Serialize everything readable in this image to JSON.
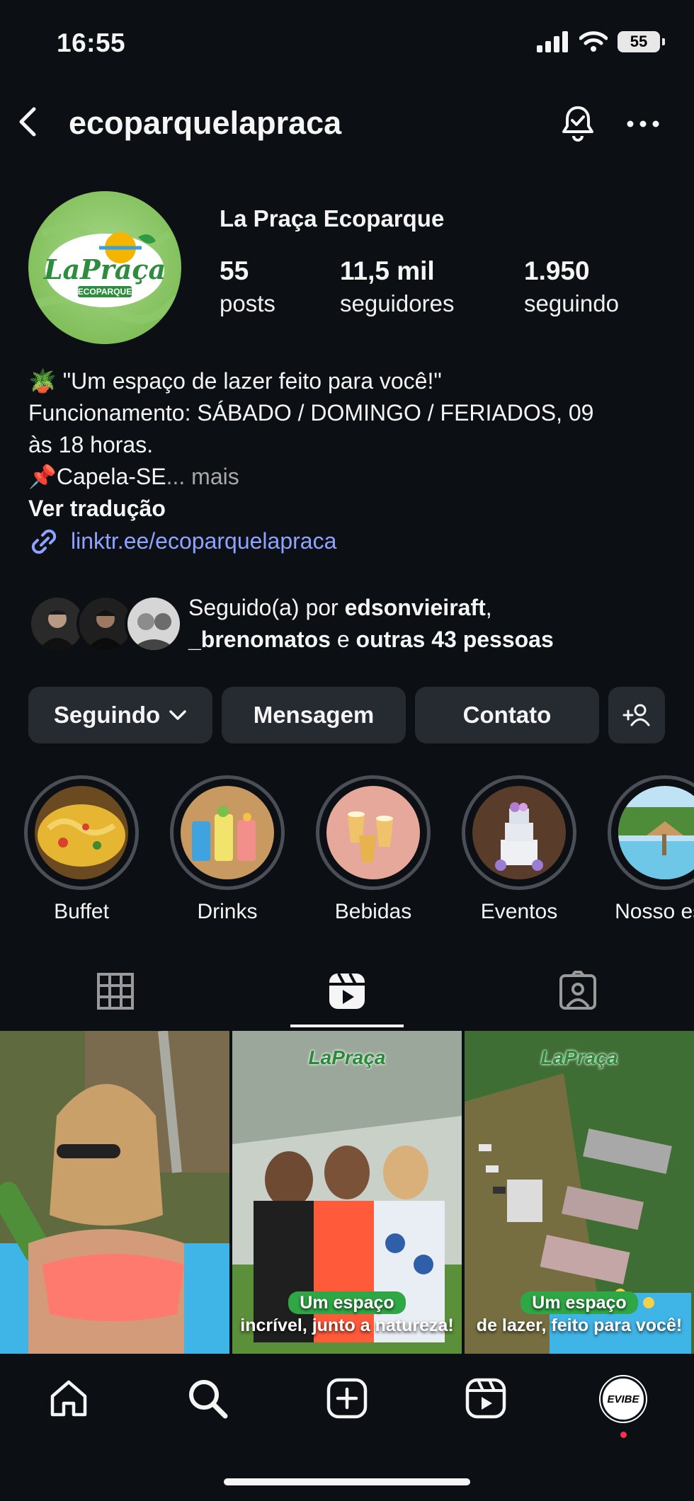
{
  "status_bar": {
    "time": "16:55",
    "battery": "55"
  },
  "header": {
    "username": "ecoparquelapraca"
  },
  "profile": {
    "display_name": "La Praça Ecoparque",
    "avatar_text": "LaPraça",
    "avatar_subtext": "ECOPARQUE",
    "stats": [
      {
        "value": "55",
        "label": "posts"
      },
      {
        "value": "11,5 mil",
        "label": "seguidores"
      },
      {
        "value": "1.950",
        "label": "seguindo"
      }
    ]
  },
  "bio": {
    "line1_emoji": "🪴",
    "line1": "\"Um espaço de lazer feito para você!\"",
    "line2": "Funcionamento: SÁBADO / DOMINGO / FERIADOS, 09",
    "line3": "às 18 horas.",
    "line4_emoji": "📌",
    "line4": "Capela-SE",
    "ellipsis": "...",
    "more": "mais",
    "translate": "Ver tradução",
    "link": "linktr.ee/ecoparquelapraca"
  },
  "followed_by": {
    "prefix": "Seguido(a) por",
    "user1": "edsonvieiraft",
    "comma": ",",
    "user2": "_brenomatos",
    "conj": "e",
    "others": "outras 43 pessoas"
  },
  "buttons": {
    "following": "Seguindo",
    "message": "Mensagem",
    "contact": "Contato"
  },
  "highlights": [
    {
      "label": "Buffet"
    },
    {
      "label": "Drinks"
    },
    {
      "label": "Bebidas"
    },
    {
      "label": "Eventos"
    },
    {
      "label": "Nosso esp"
    }
  ],
  "grid": {
    "tile2_pill": "Um espaço",
    "tile2_caption": "incrível, junto a natureza!",
    "tile3_pill": "Um espaço",
    "tile3_caption": "de lazer, feito para você!",
    "logo": "LaPraça"
  },
  "nav": {
    "avatar": "EVIBE"
  },
  "colors": {
    "background": "#0c1014",
    "button": "#262a31",
    "link": "#8ea2ff",
    "badge": "#ff3040"
  }
}
